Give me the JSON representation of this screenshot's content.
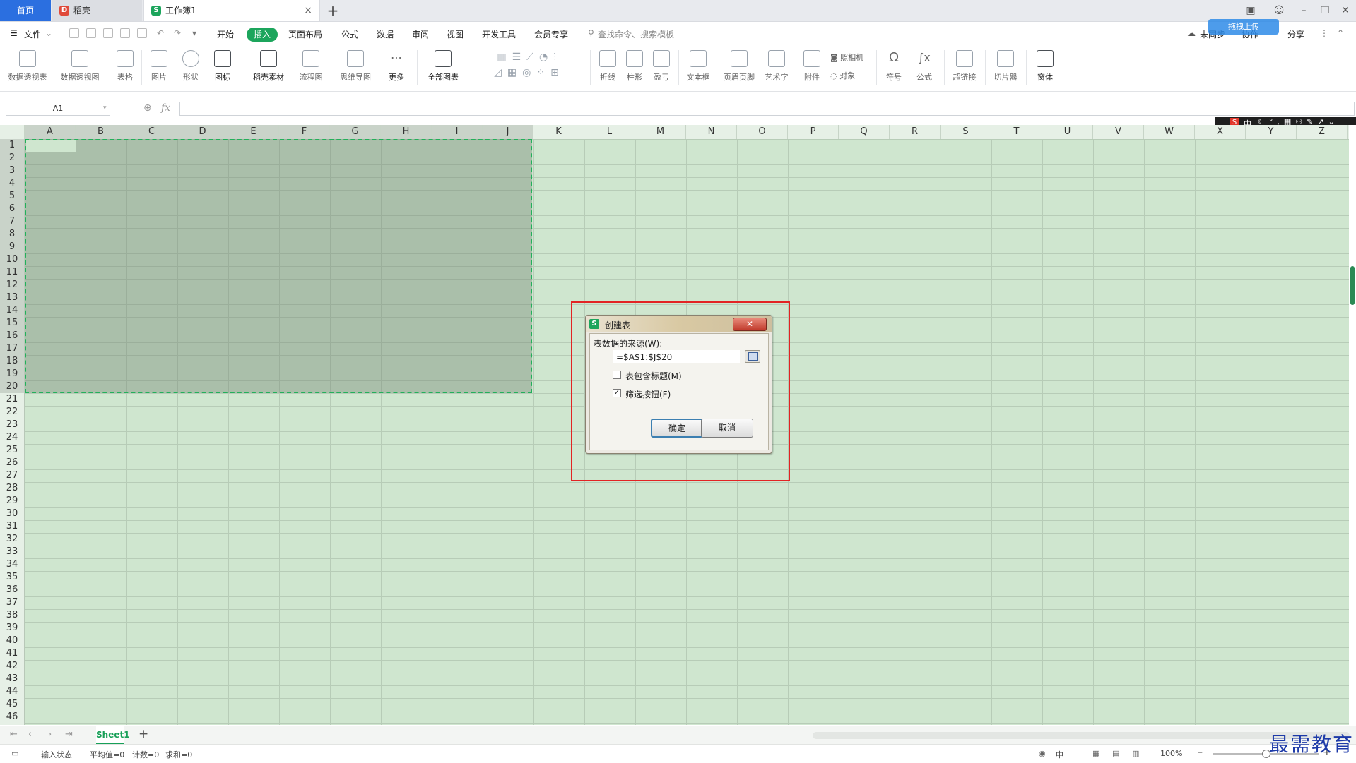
{
  "tabs": {
    "home": "首页",
    "daoke": "稻壳",
    "workbook": "工作簿1",
    "close": "×",
    "add": "+"
  },
  "window": {
    "minimize": "–",
    "restore": "❐",
    "close": "✕"
  },
  "menu": {
    "file": "文件",
    "items": [
      "开始",
      "插入",
      "页面布局",
      "公式",
      "数据",
      "审阅",
      "视图",
      "开发工具",
      "会员专享"
    ],
    "search_placeholder": "查找命令、搜索模板",
    "unsynced": "未同步",
    "collab": "协作",
    "share": "分享",
    "float_badge": "拖拽上传"
  },
  "ribbon": {
    "items": [
      "数据透视表",
      "数据透视图",
      "表格",
      "图片",
      "形状",
      "图标",
      "稻壳素材",
      "流程图",
      "思维导图",
      "更多",
      "全部图表",
      "折线",
      "柱形",
      "盈亏",
      "文本框",
      "页眉页脚",
      "艺术字",
      "附件",
      "照相机",
      "对象",
      "符号",
      "公式",
      "超链接",
      "切片器",
      "窗体"
    ]
  },
  "formula_bar": {
    "name_box": "A1",
    "fx": "fx",
    "zoom_icon": "⊕"
  },
  "ime": {
    "text": "中"
  },
  "grid": {
    "columns": [
      "A",
      "B",
      "C",
      "D",
      "E",
      "F",
      "G",
      "H",
      "I",
      "J",
      "K",
      "L",
      "M",
      "N",
      "O",
      "P",
      "Q",
      "R",
      "S",
      "T",
      "U",
      "V",
      "W",
      "X",
      "Y",
      "Z"
    ],
    "rows": [
      "1",
      "2",
      "3",
      "4",
      "5",
      "6",
      "7",
      "8",
      "9",
      "10",
      "11",
      "12",
      "13",
      "14",
      "15",
      "16",
      "17",
      "18",
      "19",
      "20",
      "21",
      "22",
      "23",
      "24",
      "25",
      "26",
      "27",
      "28",
      "29",
      "30",
      "31",
      "32",
      "33",
      "34",
      "35",
      "36",
      "37",
      "38",
      "39",
      "40",
      "41",
      "42",
      "43",
      "44",
      "45",
      "46"
    ],
    "selection": "A1:J20"
  },
  "dialog": {
    "title": "创建表",
    "source_label": "表数据的来源(W):",
    "range_value": "=$A$1:$J$20",
    "header_checkbox_label": "表包含标题(M)",
    "header_checked": false,
    "filter_checkbox_label": "筛选按钮(F)",
    "filter_checked": true,
    "ok": "确定",
    "cancel": "取消"
  },
  "sheets": {
    "active": "Sheet1",
    "add": "+"
  },
  "status": {
    "mode": "输入状态",
    "average": "平均值=0",
    "count": "计数=0",
    "sum": "求和=0",
    "zoom": "100%",
    "ime_mode": "中"
  },
  "watermark": "最需教育"
}
